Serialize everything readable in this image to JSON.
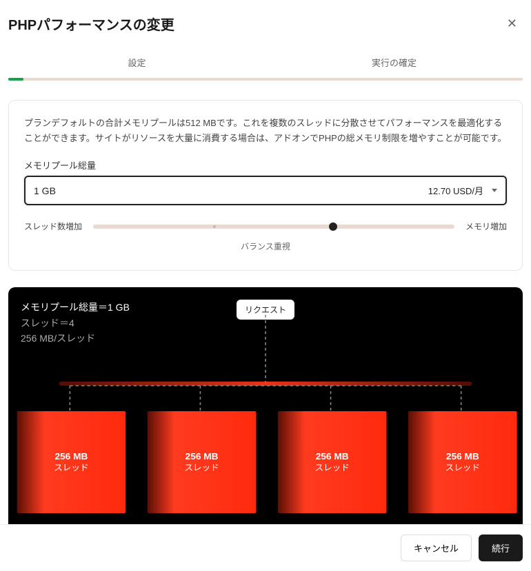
{
  "header": {
    "title": "PHPパフォーマンスの変更"
  },
  "tabs": {
    "settings": "設定",
    "confirm": "実行の確定"
  },
  "card": {
    "description": "プランデフォルトの合計メモリプールは512 MBです。これを複数のスレッドに分散させてパフォーマンスを最適化することができます。サイトがリソースを大量に消費する場合は、アドオンでPHPの総メモリ制限を増やすことが可能です。",
    "pool_label": "メモリプール総量",
    "pool_value": "1 GB",
    "pool_price": "12.70 USD/月",
    "slider_left": "スレッド数増加",
    "slider_right": "メモリ増加",
    "slider_caption": "バランス重視"
  },
  "viz": {
    "pool_line": "メモリプール総量＝1 GB",
    "threads_line": "スレッド＝4",
    "per_thread_line": "256 MB/スレッド",
    "request_label": "リクエスト",
    "threads": [
      {
        "size": "256 MB",
        "label": "スレッド"
      },
      {
        "size": "256 MB",
        "label": "スレッド"
      },
      {
        "size": "256 MB",
        "label": "スレッド"
      },
      {
        "size": "256 MB",
        "label": "スレッド"
      }
    ]
  },
  "footer": {
    "cancel": "キャンセル",
    "continue": "続行"
  }
}
